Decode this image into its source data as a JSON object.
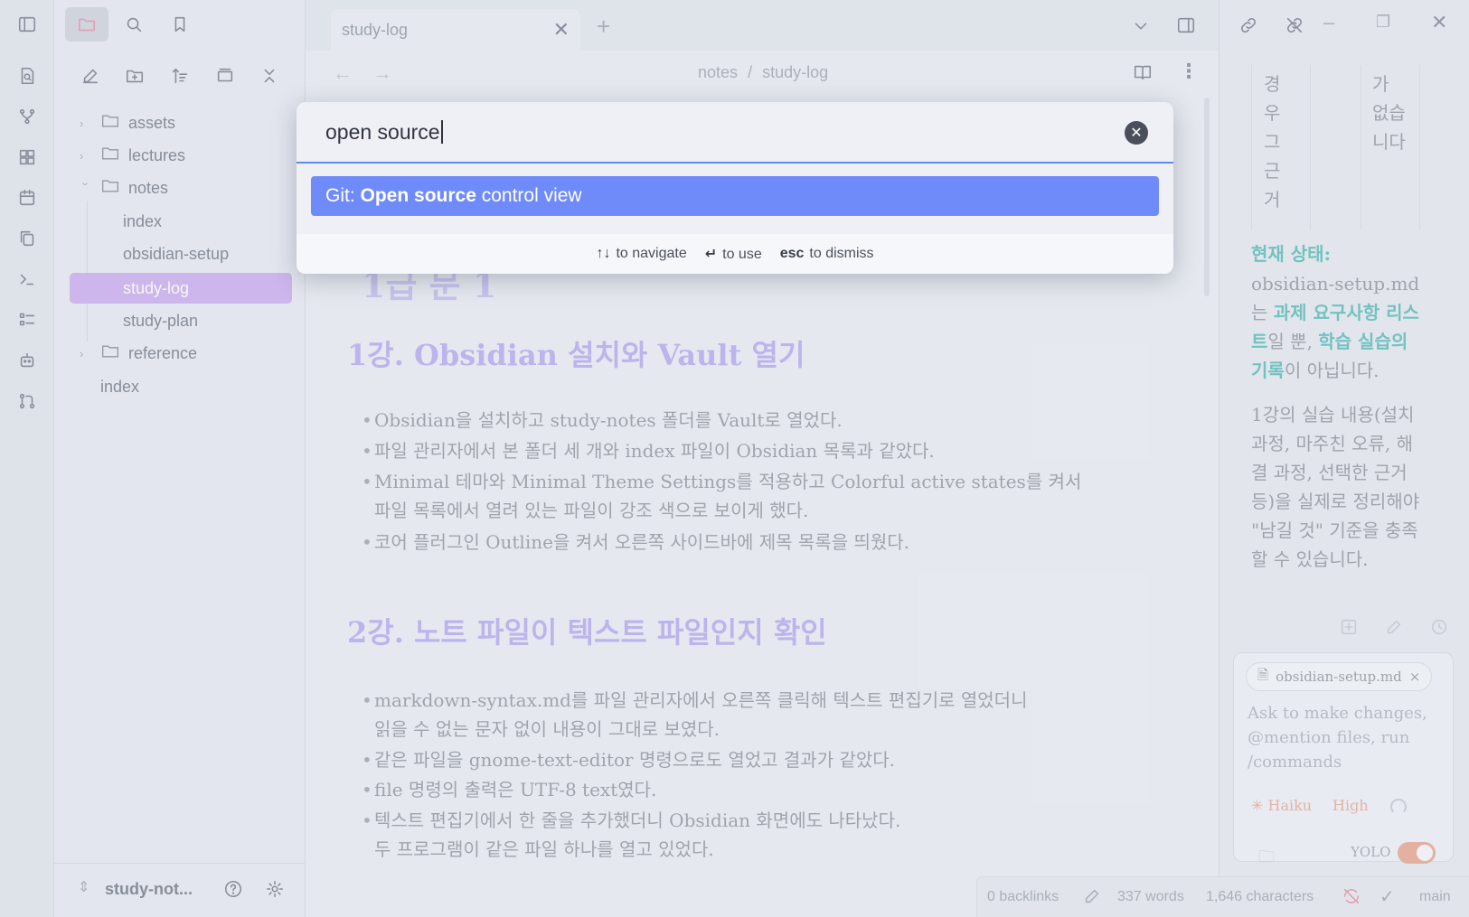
{
  "ribbon": {
    "icons": [
      "sidebar-toggle-icon",
      "file-search-icon",
      "git-graph-icon",
      "dashboard-icon",
      "calendar-icon",
      "copy-icon",
      "terminal-icon",
      "list-icon",
      "robot-icon",
      "git-pull-icon"
    ]
  },
  "explorer": {
    "top_icons": [
      "folder-icon",
      "search-icon",
      "bookmark-icon"
    ],
    "toolbar": [
      "new-note-icon",
      "new-folder-icon",
      "sort-icon",
      "collapse-view-icon",
      "close-all-icon"
    ],
    "tree": [
      {
        "label": "assets",
        "type": "folder"
      },
      {
        "label": "lectures",
        "type": "folder"
      },
      {
        "label": "notes",
        "type": "folder-open"
      },
      {
        "label": "index",
        "type": "file"
      },
      {
        "label": "obsidian-setup",
        "type": "file"
      },
      {
        "label": "study-log",
        "type": "file",
        "active": true
      },
      {
        "label": "study-plan",
        "type": "file"
      },
      {
        "label": "reference",
        "type": "folder"
      },
      {
        "label": "index",
        "type": "root-file"
      }
    ],
    "vault_name": "study-not..."
  },
  "tabs": [
    {
      "label": "study-log"
    }
  ],
  "breadcrumb": {
    "folder": "notes",
    "sep": "/",
    "file": "study-log"
  },
  "note": {
    "h1_partial": "1급 문 1",
    "section1": {
      "heading": "1강. Obsidian 설치와 Vault 열기",
      "bullets": [
        "Obsidian을 설치하고 study-notes 폴더를 Vault로 열었다.",
        "파일 관리자에서 본 폴더 세 개와 index 파일이 Obsidian 목록과 같았다.",
        "Minimal 테마와 Minimal Theme Settings를 적용하고 Colorful active states를 켜서",
        "파일 목록에서 열려 있는 파일이 강조 색으로 보이게 했다.",
        "코어 플러그인 Outline을 켜서 오른쪽 사이드바에 제목 목록을 띄웠다."
      ]
    },
    "section2": {
      "heading": "2강. 노트 파일이 텍스트 파일인지 확인",
      "bullets": [
        "markdown-syntax.md를 파일 관리자에서 오른쪽 클릭해 텍스트 편집기로 열었더니",
        "읽을 수 없는 문자 없이 내용이 그대로 보였다.",
        "같은 파일을 gnome-text-editor 명령으로도 열었고 결과가 같았다.",
        "file 명령의 출력은 UTF-8 text였다.",
        "텍스트 편집기에서 한 줄을 추가했더니 Obsidian 화면에도 나타났다.",
        "두 프로그램이 같은 파일 하나를 열고 있었다."
      ]
    }
  },
  "right_panel": {
    "table_col1": [
      "경",
      "우",
      "그",
      "근",
      "거"
    ],
    "table_col2": [
      "가",
      "없습",
      "니다"
    ],
    "status_label": "현재 상태:",
    "para1_parts": [
      "obsidian-setup.md",
      "는 ",
      "과제 요구사항 리스트",
      "일 뿐, ",
      "학습 실습의 기록",
      "이 아닙니다."
    ],
    "para2": "1강의 실습 내용(설치 과정, 마주친 오류, 해결 과정, 선택한 근거 등)을 실제로 정리해야 \"남길 것\" 기준을 충족할 수 있습니다.",
    "chat": {
      "file_chip": "obsidian-setup.md",
      "placeholder": "Ask to make changes, @mention files, run /commands",
      "model": "Haiku",
      "effort": "High",
      "yolo_label": "YOLO"
    }
  },
  "statusbar": {
    "backlinks": "0 backlinks",
    "words": "337 words",
    "chars": "1,646 characters",
    "branch": "main"
  },
  "palette": {
    "query": "open source",
    "suggestion": {
      "prefix": "Git: ",
      "match": "Open source",
      "rest": " control view"
    },
    "hints": [
      {
        "key": "↑↓",
        "label": "to navigate"
      },
      {
        "key": "↵",
        "label": "to use"
      },
      {
        "key": "esc",
        "label": "to dismiss"
      }
    ]
  }
}
